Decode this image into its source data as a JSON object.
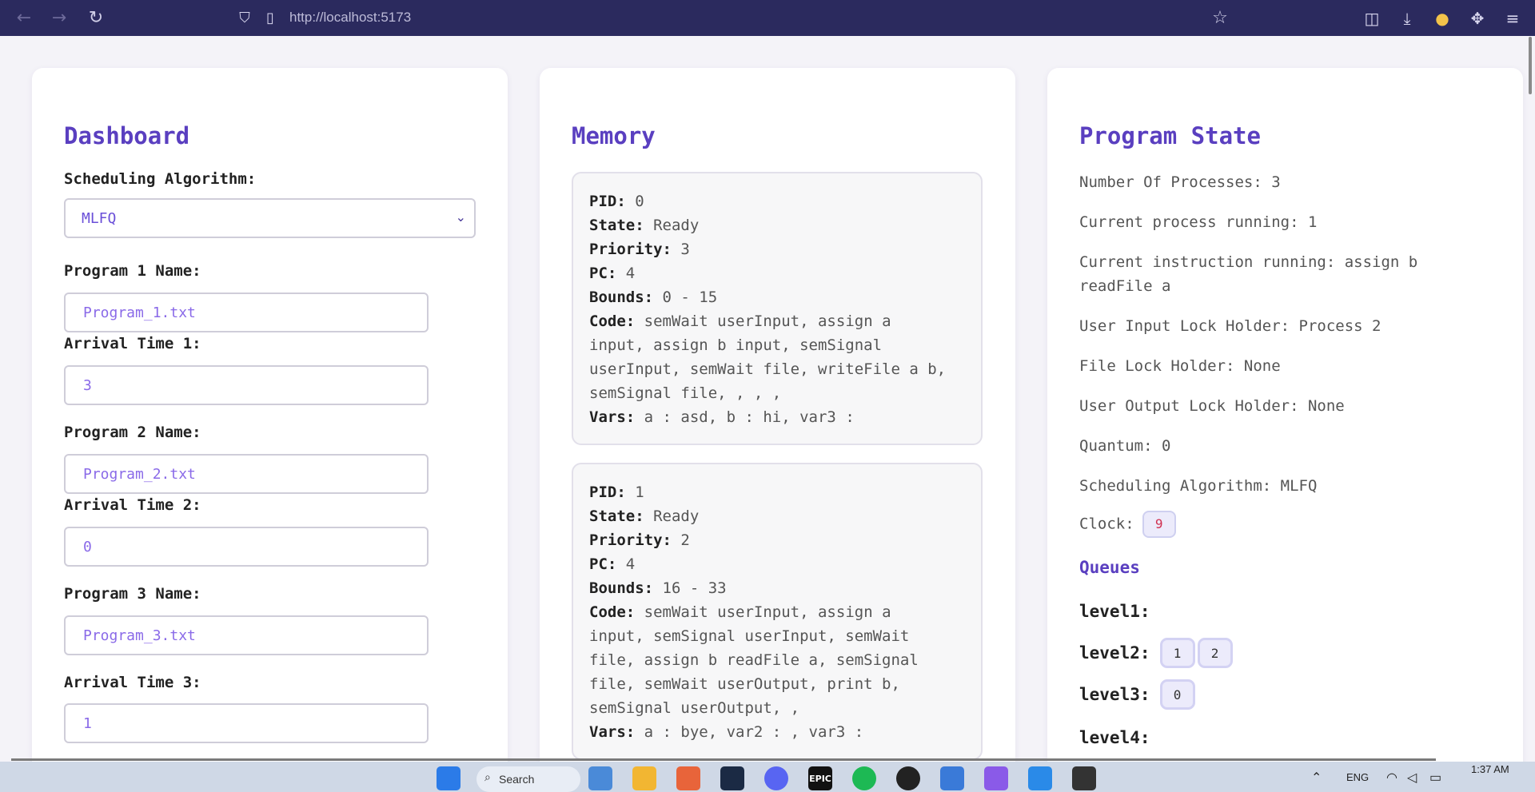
{
  "browser": {
    "url": "http://localhost:5173",
    "back_icon": "←",
    "forward_icon": "→",
    "reload_icon": "↻",
    "shield_icon": "⛉",
    "page_icon": "▯",
    "star_icon": "☆",
    "pocket_icon": "◫",
    "download_icon": "⤓",
    "profile_icon": "●",
    "extensions_icon": "✥",
    "menu_icon": "≡"
  },
  "dashboard": {
    "title": "Dashboard",
    "algorithm_label": "Scheduling Algorithm:",
    "algorithm_value": "MLFQ",
    "chevron": "⌄",
    "programs": [
      {
        "name_label": "Program 1 Name:",
        "name_value": "Program_1.txt",
        "arrival_label": "Arrival Time 1:",
        "arrival_value": "3"
      },
      {
        "name_label": "Program 2 Name:",
        "name_value": "Program_2.txt",
        "arrival_label": "Arrival Time 2:",
        "arrival_value": "0"
      },
      {
        "name_label": "Program 3 Name:",
        "name_value": "Program_3.txt",
        "arrival_label": "Arrival Time 3:",
        "arrival_value": "1"
      }
    ]
  },
  "memory": {
    "title": "Memory",
    "labels": {
      "pid": "PID:",
      "state": "State:",
      "priority": "Priority:",
      "pc": "PC:",
      "bounds": "Bounds:",
      "code": "Code:",
      "vars": "Vars:"
    },
    "processes": [
      {
        "pid": "0",
        "state": "Ready",
        "priority": "3",
        "pc": "4",
        "bounds": "0 - 15",
        "code_lines": [
          "semWait userInput, assign a",
          "input, assign b input, semSignal",
          "userInput, semWait file, writeFile a b,",
          "semSignal file, , , ,"
        ],
        "vars": "a : asd, b : hi, var3 :"
      },
      {
        "pid": "1",
        "state": "Ready",
        "priority": "2",
        "pc": "4",
        "bounds": "16 - 33",
        "code_lines": [
          "semWait userInput, assign a",
          "input, semSignal userInput, semWait",
          "file, assign b readFile a, semSignal",
          "file, semWait userOutput, print b,",
          "semSignal userOutput, ,"
        ],
        "vars": "a : bye, var2 : , var3 :"
      }
    ]
  },
  "program_state": {
    "title": "Program State",
    "num_processes": "Number Of Processes: 3",
    "current_process": "Current process running: 1",
    "current_instruction_1": "Current instruction running: assign b",
    "current_instruction_2": "readFile a",
    "input_lock": "User Input Lock Holder: Process 2",
    "file_lock": "File Lock Holder: None",
    "output_lock": "User Output Lock Holder: None",
    "quantum": "Quantum: 0",
    "algorithm": "Scheduling Algorithm: MLFQ",
    "clock_label": "Clock:",
    "clock_value": "9",
    "queues_title": "Queues",
    "levels": [
      {
        "label": "level1:",
        "items": []
      },
      {
        "label": "level2:",
        "items": [
          "1",
          "2"
        ]
      },
      {
        "label": "level3:",
        "items": [
          "0"
        ]
      },
      {
        "label": "level4:",
        "items": []
      }
    ]
  },
  "taskbar": {
    "search_label": "Search",
    "search_icon": "⌕",
    "epic_label": "EPIC",
    "chevron_up": "⌃",
    "language": "ENG",
    "wifi_icon": "◠",
    "volume_icon": "◁",
    "battery_icon": "▭",
    "time": "1:37 AM"
  }
}
